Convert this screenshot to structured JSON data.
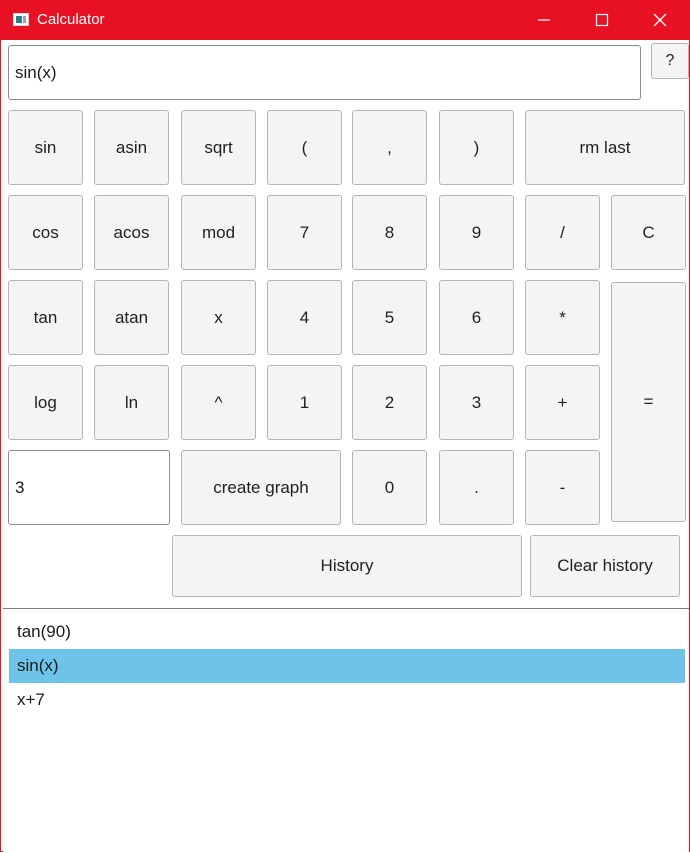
{
  "window": {
    "title": "Calculator",
    "accent": "#e81123",
    "icons": {
      "app": "calculator-app-icon",
      "minimize": "minimize-icon",
      "maximize": "maximize-icon",
      "close": "close-icon"
    }
  },
  "expression": {
    "value": "sin(x)"
  },
  "help": {
    "label": "?"
  },
  "keys": {
    "sin": "sin",
    "asin": "asin",
    "sqrt": "sqrt",
    "lparen": "(",
    "comma": ",",
    "rparen": ")",
    "rmlast": "rm last",
    "cos": "cos",
    "acos": "acos",
    "mod": "mod",
    "n7": "7",
    "n8": "8",
    "n9": "9",
    "divide": "/",
    "clear": "C",
    "tan": "tan",
    "atan": "atan",
    "x": "x",
    "n4": "4",
    "n5": "5",
    "n6": "6",
    "multiply": "*",
    "log": "log",
    "ln": "ln",
    "pow": "^",
    "n1": "1",
    "n2": "2",
    "n3": "3",
    "plus": "+",
    "equals": "=",
    "create_graph": "create graph",
    "n0": "0",
    "dot": ".",
    "minus": "-"
  },
  "graph_input": {
    "value": "3"
  },
  "history": {
    "button": "History",
    "clear_button": "Clear history",
    "selected_color": "#6ec4e8",
    "items": [
      "tan(90)",
      "sin(x)",
      "x+7"
    ],
    "selected_index": 1
  }
}
